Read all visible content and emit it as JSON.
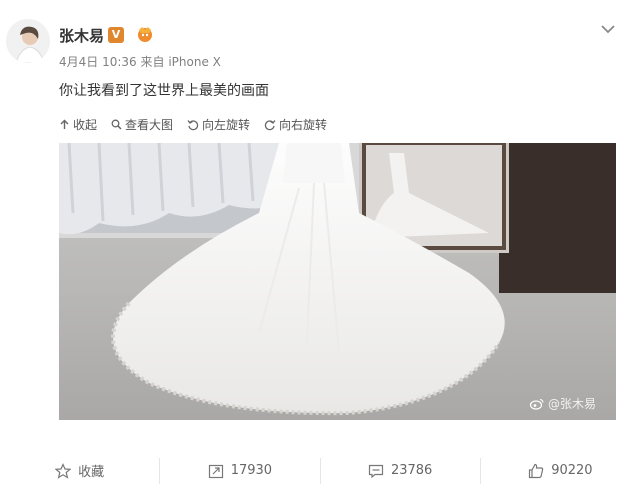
{
  "post": {
    "username": "张木易",
    "verified_badge": "V",
    "timestamp": "4月4日 10:36",
    "source": "来自 iPhone X",
    "text": "你让我看到了这世界上最美的画面"
  },
  "toolbar": {
    "collapse": "收起",
    "view_large": "查看大图",
    "rotate_left": "向左旋转",
    "rotate_right": "向右旋转"
  },
  "image": {
    "watermark": "@张木易"
  },
  "actions": {
    "favorite": "收藏",
    "repost": "17930",
    "comment": "23786",
    "like": "90220"
  },
  "icons": [
    "chevron-down-icon",
    "collapse-arrow-icon",
    "zoom-icon",
    "rotate-left-icon",
    "rotate-right-icon",
    "star-icon",
    "repost-icon",
    "comment-icon",
    "thumbs-up-icon",
    "weibo-logo-icon"
  ],
  "colors": {
    "badge": "#e0862c",
    "text": "#333333",
    "meta": "#808080"
  }
}
